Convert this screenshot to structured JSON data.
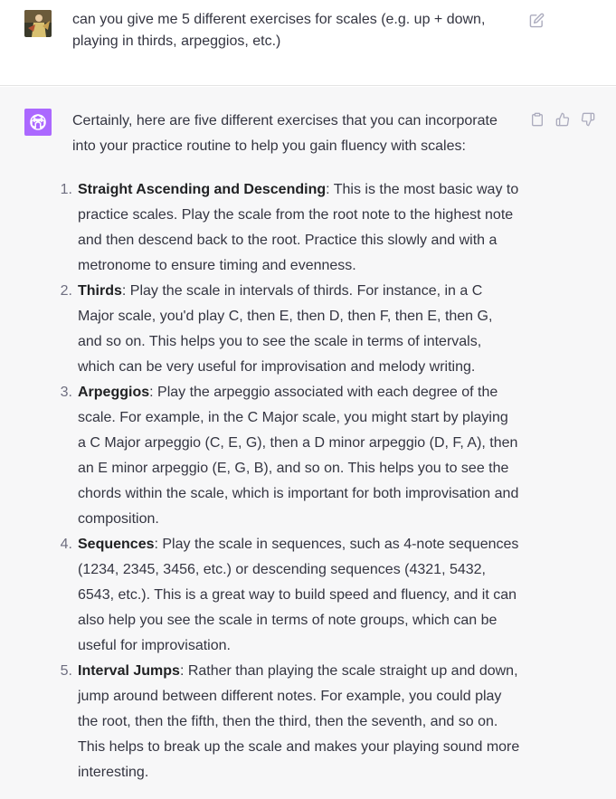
{
  "user_message": {
    "text": "can you give me 5 different exercises for scales (e.g. up + down, playing in thirds, arpeggios, etc.)",
    "icons": {
      "avatar": "user-avatar-photo",
      "edit": "edit-icon"
    }
  },
  "assistant_message": {
    "intro": "Certainly, here are five different exercises that you can incorporate into your practice routine to help you gain fluency with scales:",
    "exercises": [
      {
        "number": "1.",
        "title": "Straight Ascending and Descending",
        "body": ": This is the most basic way to practice scales. Play the scale from the root note to the highest note and then descend back to the root. Practice this slowly and with a metronome to ensure timing and evenness."
      },
      {
        "number": "2.",
        "title": "Thirds",
        "body": ": Play the scale in intervals of thirds. For instance, in a C Major scale, you'd play C, then E, then D, then F, then E, then G, and so on. This helps you to see the scale in terms of intervals, which can be very useful for improvisation and melody writing."
      },
      {
        "number": "3.",
        "title": "Arpeggios",
        "body": ": Play the arpeggio associated with each degree of the scale. For example, in the C Major scale, you might start by playing a C Major arpeggio (C, E, G), then a D minor arpeggio (D, F, A), then an E minor arpeggio (E, G, B), and so on. This helps you to see the chords within the scale, which is important for both improvisation and composition."
      },
      {
        "number": "4.",
        "title": "Sequences",
        "body": ": Play the scale in sequences, such as 4-note sequences (1234, 2345, 3456, etc.) or descending sequences (4321, 5432, 6543, etc.). This is a great way to build speed and fluency, and it can also help you see the scale in terms of note groups, which can be useful for improvisation."
      },
      {
        "number": "5.",
        "title": "Interval Jumps",
        "body": ": Rather than playing the scale straight up and down, jump around between different notes. For example, you could play the root, then the fifth, then the third, then the seventh, and so on. This helps to break up the scale and makes your playing sound more interesting."
      }
    ],
    "icons": {
      "avatar": "openai-logo-icon",
      "copy": "clipboard-icon",
      "like": "thumbs-up-icon",
      "dislike": "thumbs-down-icon"
    }
  },
  "colors": {
    "assistant_bg": "#f7f7f8",
    "gpt_avatar": "#ab68ff",
    "text": "#343541",
    "icon": "#acacbe"
  }
}
